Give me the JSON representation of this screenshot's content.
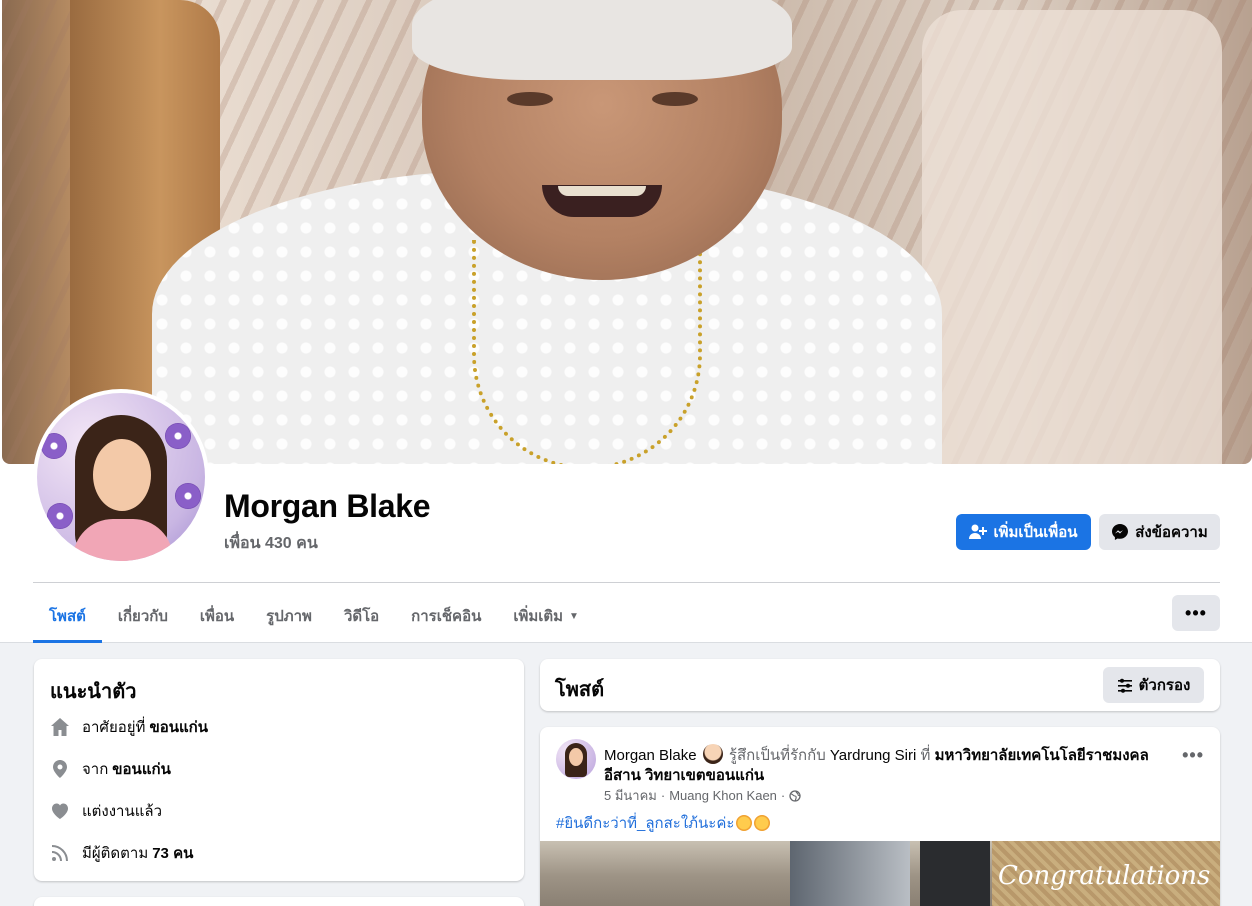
{
  "profile": {
    "name": "Morgan Blake",
    "friends": "เพื่อน 430 คน"
  },
  "actions": {
    "add_friend": "เพิ่มเป็นเพื่อน",
    "message": "ส่งข้อความ"
  },
  "tabs": [
    {
      "label": "โพสต์",
      "active": true
    },
    {
      "label": "เกี่ยวกับ"
    },
    {
      "label": "เพื่อน"
    },
    {
      "label": "รูปภาพ"
    },
    {
      "label": "วิดีโอ"
    },
    {
      "label": "การเช็คอิน"
    },
    {
      "label": "เพิ่มเติม"
    }
  ],
  "more_menu": "•••",
  "intro": {
    "title": "แนะนำตัว",
    "lives_prefix": "อาศัยอยู่ที่",
    "lives_value": "ขอนแก่น",
    "from_prefix": "จาก",
    "from_value": "ขอนแก่น",
    "relationship": "แต่งงานแล้ว",
    "followers_prefix": "มีผู้ติดตาม",
    "followers_value": "73 คน"
  },
  "posts_section": {
    "title": "โพสต์",
    "filter_label": "ตัวกรอง"
  },
  "post": {
    "author": "Morgan Blake",
    "feeling": "รู้สึกเป็นที่รักกับ",
    "tagged": "Yardrung Siri",
    "at": "ที่",
    "place": "มหาวิทยาลัยเทคโนโลยีราชมงคลอีสาน วิทยาเขตขอนแก่น",
    "date": "5 มีนาคม",
    "location": "Muang Khon Kaen",
    "sep": "·",
    "text": "#ยินดีกะว่าที่_ลูกสะใภ้นะค่ะ",
    "image_text": "Congratulations",
    "more": "•••"
  },
  "colors": {
    "accent": "#1b74e4",
    "text_secondary": "#65676b",
    "background": "#f0f2f5"
  }
}
